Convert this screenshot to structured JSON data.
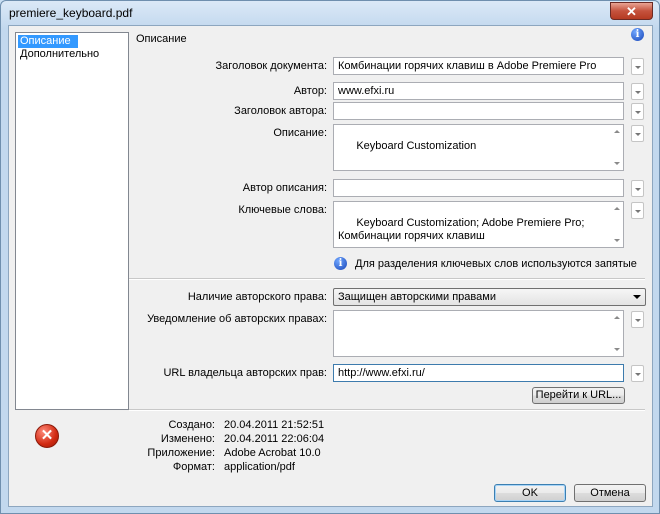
{
  "window": {
    "title": "premiere_keyboard.pdf",
    "close_glyph": "✕"
  },
  "sidebar": {
    "items": [
      {
        "label": "Описание"
      },
      {
        "label": "Дополнительно"
      }
    ]
  },
  "section": {
    "title": "Описание"
  },
  "fields": {
    "doc_title": {
      "label": "Заголовок документа:",
      "value": "Комбинации горячих клавиш в Adobe Premiere Pro"
    },
    "author": {
      "label": "Автор:",
      "value": "www.efxi.ru"
    },
    "author_title": {
      "label": "Заголовок автора:",
      "value": ""
    },
    "description": {
      "label": "Описание:",
      "value": "Keyboard Customization"
    },
    "description_author": {
      "label": "Автор описания:",
      "value": ""
    },
    "keywords": {
      "label": "Ключевые слова:",
      "value": "Keyboard Customization; Adobe Premiere Pro; Комбинации горячих клавиш"
    },
    "keywords_hint": "Для разделения ключевых слов используются запятые",
    "copyright_status": {
      "label": "Наличие авторского права:",
      "value": "Защищен авторскими правами"
    },
    "copyright_notice": {
      "label": "Уведомление об авторских правах:",
      "value": ""
    },
    "copyright_url": {
      "label": "URL владельца авторских прав:",
      "value": "http://www.efxi.ru/"
    }
  },
  "buttons": {
    "go_to_url": "Перейти к URL...",
    "ok": "OK",
    "cancel": "Отмена"
  },
  "meta": {
    "created": {
      "label": "Создано:",
      "value": "20.04.2011 21:52:51"
    },
    "modified": {
      "label": "Изменено:",
      "value": "20.04.2011 22:06:04"
    },
    "application": {
      "label": "Приложение:",
      "value": "Adobe Acrobat 10.0"
    },
    "format": {
      "label": "Формат:",
      "value": "application/pdf"
    }
  },
  "icons": {
    "info": "i",
    "error": "✕"
  }
}
